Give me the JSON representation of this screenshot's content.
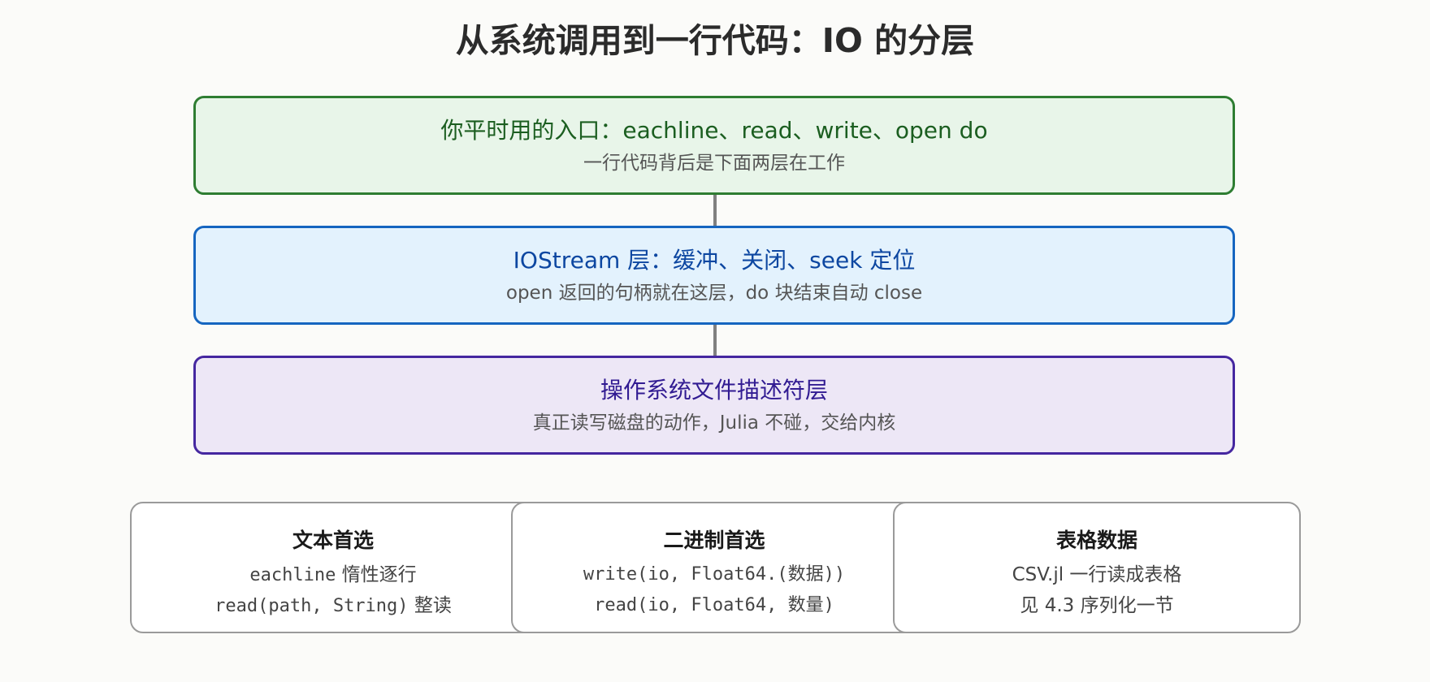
{
  "title": "从系统调用到一行代码：IO 的分层",
  "layers": [
    {
      "title": "你平时用的入口：eachline、read、write、open do",
      "subtitle": "一行代码背后是下面两层在工作",
      "border_color": "#2e7d32",
      "fill_color": "#e8f5e9",
      "text_color": "#1b5e20"
    },
    {
      "title": "IOStream 层：缓冲、关闭、seek 定位",
      "subtitle": "open 返回的句柄就在这层，do 块结束自动 close",
      "border_color": "#1565c0",
      "fill_color": "#e3f2fd",
      "text_color": "#0d47a1"
    },
    {
      "title": "操作系统文件描述符层",
      "subtitle": "真正读写磁盘的动作，Julia 不碰，交给内核",
      "border_color": "#4527a0",
      "fill_color": "#ede7f6",
      "text_color": "#311b92"
    }
  ],
  "cards": [
    {
      "title": "文本首选",
      "lines": [
        "eachline 惰性逐行",
        "read(path, String) 整读"
      ]
    },
    {
      "title": "二进制首选",
      "lines": [
        "write(io, Float64.(数据))",
        "read(io, Float64, 数量)"
      ]
    },
    {
      "title": "表格数据",
      "lines": [
        "CSV.jl 一行读成表格",
        "见 4.3 序列化一节"
      ]
    }
  ]
}
